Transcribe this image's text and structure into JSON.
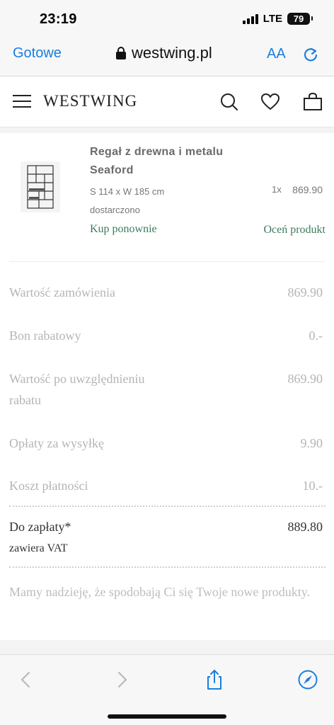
{
  "status_bar": {
    "time": "23:19",
    "network": "LTE",
    "battery": "79"
  },
  "browser": {
    "done_label": "Gotowe",
    "url": "westwing.pl",
    "text_size_label": "AA"
  },
  "site_header": {
    "logo": "WESTWING"
  },
  "product": {
    "name": "Regał z drewna i metalu Seaford",
    "size": "S 114 x W 185 cm",
    "status": "dostarczono",
    "quantity": "1x",
    "price": "869.90",
    "buy_again_label": "Kup ponownie",
    "rate_label": "Oceń produkt"
  },
  "summary": {
    "rows": [
      {
        "label": "Wartość zamówienia",
        "value": "869.90"
      },
      {
        "label": "Bon rabatowy",
        "value": "0.-"
      },
      {
        "label": "Wartość po uwzględnieniu rabatu",
        "value": "869.90"
      },
      {
        "label": "Opłaty za wysyłkę",
        "value": "9.90"
      },
      {
        "label": "Koszt płatności",
        "value": "10.-"
      }
    ],
    "total_label": "Do zapłaty*",
    "total_value": "889.80",
    "vat_note": "zawiera VAT"
  },
  "thanks_message": "Mamy nadzieję, że spodobają Ci się Twoje nowe produkty.",
  "colors": {
    "accent_blue": "#1a7ee0",
    "brand_green": "#3e7b5d"
  }
}
